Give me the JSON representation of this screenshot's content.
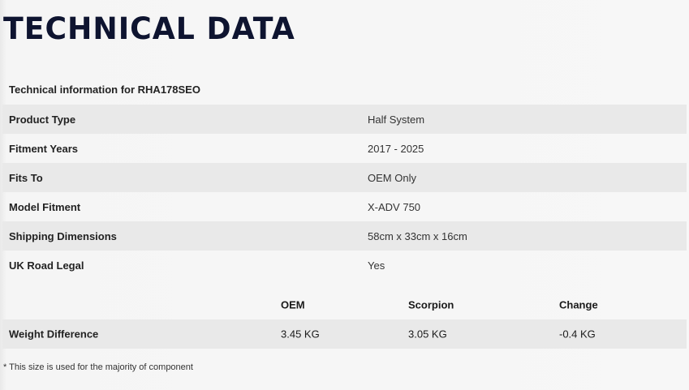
{
  "page": {
    "title": "TECHNICAL DATA",
    "caption": "Technical information for RHA178SEO"
  },
  "specs": [
    {
      "label": "Product Type",
      "value": "Half System"
    },
    {
      "label": "Fitment Years",
      "value": "2017 - 2025"
    },
    {
      "label": "Fits To",
      "value": "OEM Only"
    },
    {
      "label": "Model Fitment",
      "value": "X-ADV 750"
    },
    {
      "label": "Shipping Dimensions",
      "value": "58cm x 33cm x 16cm"
    },
    {
      "label": "UK Road Legal",
      "value": "Yes"
    }
  ],
  "weight": {
    "headers": {
      "oem": "OEM",
      "scorpion": "Scorpion",
      "change": "Change"
    },
    "row": {
      "label": "Weight Difference",
      "oem": "3.45 KG",
      "scorpion": "3.05 KG",
      "change": "-0.4 KG"
    }
  },
  "footnote": "* This size is used for the majority of component",
  "colors": {
    "title": "#0e1430",
    "row_shade": "#e9e9e9",
    "background": "#f7f7f7"
  }
}
